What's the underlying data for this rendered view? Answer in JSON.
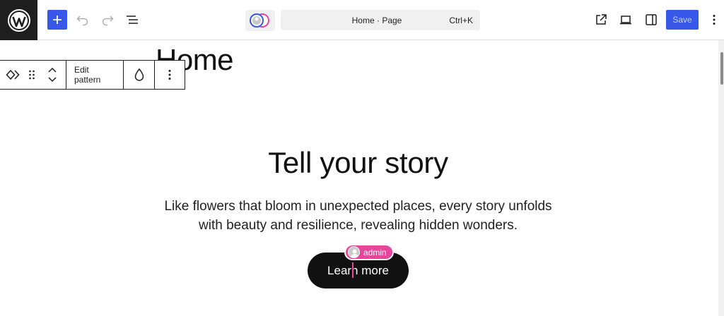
{
  "topbar": {
    "cmd_title": "Home · Page",
    "cmd_shortcut": "Ctrl+K",
    "save_label": "Save",
    "icons": [
      "wordpress-icon",
      "plus-icon",
      "undo-icon",
      "redo-icon",
      "document-overview-icon",
      "collaborators-icon",
      "view-icon",
      "device-preview-icon",
      "sidebar-icon",
      "more-options-icon"
    ]
  },
  "block_toolbar": {
    "edit_pattern_label": "Edit pattern",
    "icons": [
      "pattern-icon",
      "drag-handle-icon",
      "move-up-icon",
      "move-down-icon",
      "styles-icon",
      "more-options-icon"
    ]
  },
  "content": {
    "page_title": "Home",
    "hero_heading": "Tell your story",
    "hero_text": "Like flowers that bloom in unexpected places, every story unfolds with beauty and resilience, revealing hidden wonders.",
    "button_label": "Learn more"
  },
  "presence": {
    "user": "admin"
  },
  "colors": {
    "accent": "#3858e9",
    "presence": "#e6479b",
    "dark": "#1e1e1e"
  }
}
